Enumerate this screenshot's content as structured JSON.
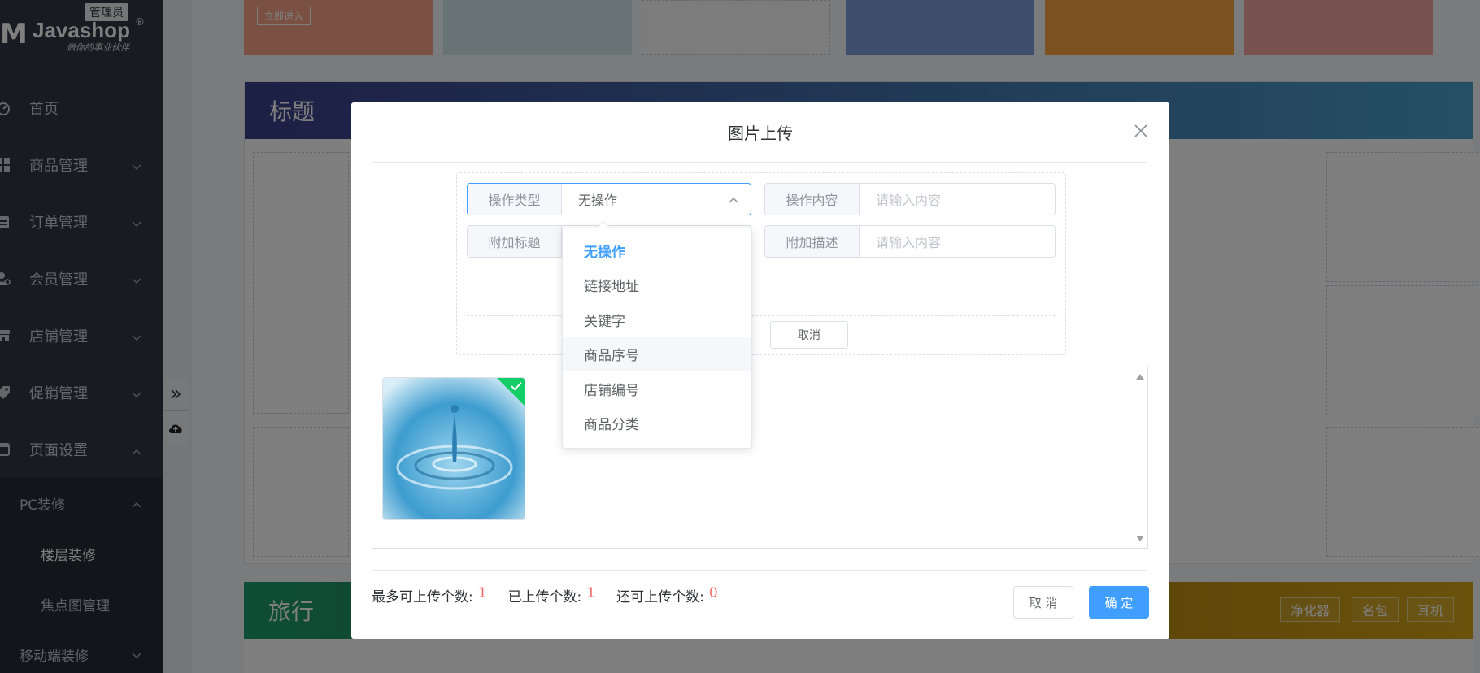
{
  "sidebar": {
    "brand": "Javashop",
    "badge": "管理员",
    "slogan": "做你的事业伙伴",
    "items": [
      {
        "label": "首页"
      },
      {
        "label": "商品管理"
      },
      {
        "label": "订单管理"
      },
      {
        "label": "会员管理"
      },
      {
        "label": "店铺管理"
      },
      {
        "label": "促销管理"
      },
      {
        "label": "页面设置"
      }
    ],
    "sub": {
      "group": "PC装修",
      "items": [
        {
          "label": "楼层装修"
        },
        {
          "label": "焦点图管理"
        }
      ],
      "mobile": "移动端装修"
    }
  },
  "background": {
    "banner_button": "立即进入",
    "floor1_title": "标题",
    "floor2_title": "旅行",
    "tags": [
      "净化器",
      "名包",
      "耳机"
    ]
  },
  "dialog": {
    "title": "图片上传",
    "fields": {
      "action_type_label": "操作类型",
      "action_type_value": "无操作",
      "action_content_label": "操作内容",
      "action_content_placeholder": "请输入内容",
      "extra_title_label": "附加标题",
      "extra_desc_label": "附加描述",
      "extra_desc_placeholder": "请输入内容"
    },
    "form_cancel": "取消",
    "dropdown_options": [
      "无操作",
      "链接地址",
      "关键字",
      "商品序号",
      "店铺编号",
      "商品分类"
    ],
    "stats": {
      "max_label": "最多可上传个数:",
      "max_value": "1",
      "uploaded_label": "已上传个数:",
      "uploaded_value": "1",
      "remaining_label": "还可上传个数:",
      "remaining_value": "0"
    },
    "cancel_button": "取 消",
    "ok_button": "确 定"
  },
  "colors": {
    "primary": "#409eff",
    "danger": "#f56c6c",
    "sidebar_bg": "#303643",
    "floor1_head": "#3a3f8a",
    "floor2_head": "#1d9a6c"
  }
}
